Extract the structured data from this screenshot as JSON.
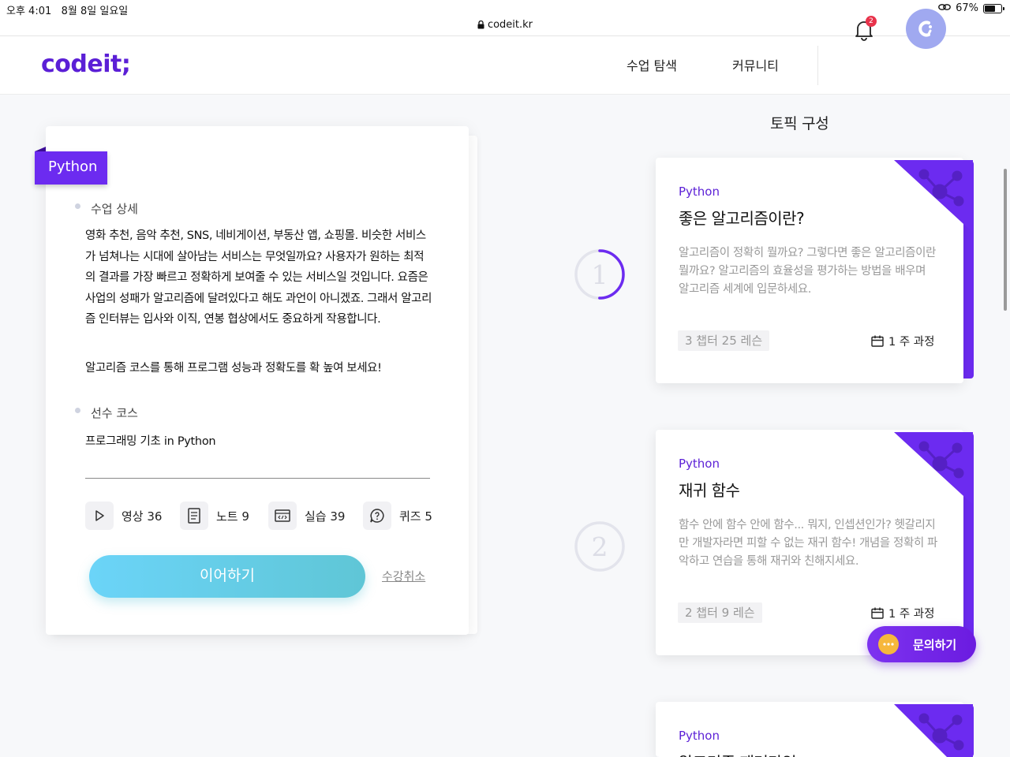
{
  "status_bar": {
    "time": "오후 4:01",
    "date": "8월 8일 일요일",
    "battery": "67%",
    "battery_level": 0.67
  },
  "browser": {
    "url": "codeit.kr"
  },
  "header": {
    "logo": "codeit;",
    "nav": {
      "courses": "수업 탐색",
      "community": "커뮤니티"
    },
    "notification_count": "2"
  },
  "course": {
    "tag": "Python",
    "detail_label": "수업 상세",
    "description": "영화 추천, 음악 추천, SNS, 네비게이션, 부동산 앱, 쇼핑몰. 비슷한 서비스가 넘쳐나는 시대에 살아남는 서비스는 무엇일까요? 사용자가 원하는 최적의 결과를 가장 빠르고 정확하게 보여줄 수 있는 서비스일 것입니다. 요즘은 사업의 성패가 알고리즘에 달려있다고 해도 과언이 아니겠죠. 그래서 알고리즘 인터뷰는 입사와 이직, 연봉 협상에서도 중요하게 작용합니다.",
    "description2": "알고리즘 코스를 통해 프로그램 성능과 정확도를 확 높여 보세요!",
    "prereq_label": "선수 코스",
    "prereq_course": "프로그래밍 기초 in Python",
    "stats": {
      "video": "영상 36",
      "note": "노트 9",
      "practice": "실습 39",
      "quiz": "퀴즈 5"
    },
    "continue_label": "이어하기",
    "cancel_label": "수강취소"
  },
  "topics": {
    "title": "토픽 구성",
    "items": [
      {
        "number": "1",
        "lang": "Python",
        "title": "좋은 알고리즘이란?",
        "desc": "알고리즘이 정확히 뭘까요? 그렇다면 좋은 알고리즘이란 뭘까요? 알고리즘의 효율성을 평가하는 방법을 배우며 알고리즘 세계에 입문하세요.",
        "chapters": "3 챕터 25 레슨",
        "duration": "1 주 과정",
        "progress": 0.5
      },
      {
        "number": "2",
        "lang": "Python",
        "title": "재귀 함수",
        "desc": "함수 안에 함수 안에 함수... 뭐지, 인셉션인가? 헷갈리지만 개발자라면 피할 수 없는 재귀 함수! 개념을 정확히 파악하고 연습을 통해 재귀와 친해지세요.",
        "chapters": "2 챕터 9 레슨",
        "duration": "1 주 과정",
        "progress": 0
      },
      {
        "lang": "Python",
        "title": "알고리즘 패러다임"
      }
    ]
  },
  "help_button": "문의하기",
  "colors": {
    "brand": "#6c2bf0",
    "accent_cyan": "#6bd4f8",
    "badge_red": "#e8334b"
  }
}
